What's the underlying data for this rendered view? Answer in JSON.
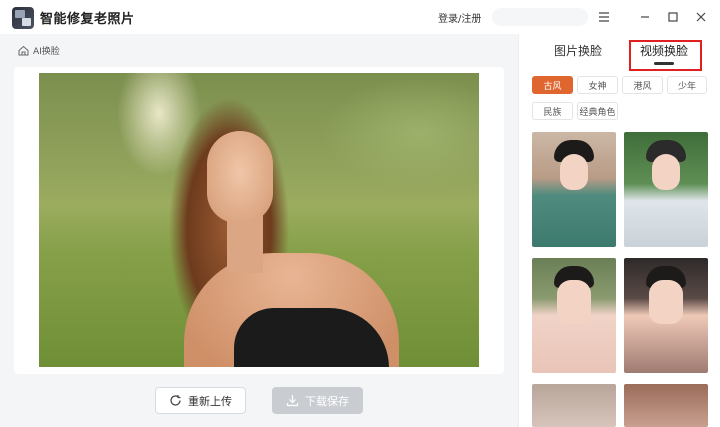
{
  "app": {
    "title": "智能修复老照片"
  },
  "header": {
    "login_label": "登录/注册"
  },
  "breadcrumb": {
    "label": "AI换脸"
  },
  "actions": {
    "reupload_label": "重新上传",
    "save_label": "下载保存"
  },
  "panel": {
    "tabs": [
      {
        "label": "图片换脸",
        "active": false
      },
      {
        "label": "视频换脸",
        "active": true
      }
    ],
    "categories": [
      {
        "label": "古风",
        "active": true
      },
      {
        "label": "女神",
        "active": false
      },
      {
        "label": "港风",
        "active": false
      },
      {
        "label": "少年",
        "active": false
      },
      {
        "label": "民族",
        "active": false
      },
      {
        "label": "经典角色",
        "active": false
      }
    ]
  },
  "colors": {
    "accent": "#e0662f",
    "highlight": "#e02020",
    "disabled": "#c9ccd1"
  }
}
